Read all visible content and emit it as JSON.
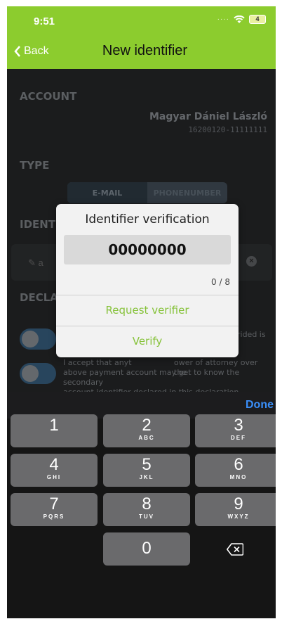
{
  "status": {
    "time": "9:51",
    "battery": "4"
  },
  "nav": {
    "back": "Back",
    "title": "New identifier"
  },
  "form": {
    "account_heading": "ACCOUNT",
    "account_name": "Magyar Dániel László",
    "account_number": "16200120-11111111",
    "type_heading": "TYPE",
    "type_options": [
      "E-MAIL",
      "PHONENUMBER"
    ],
    "type_selected": "E-MAIL",
    "identifier_heading": "IDENT",
    "identifier_value": "a",
    "declaration_heading": "DECLA",
    "declaration_1_partial": "rided is",
    "declaration_2_line1_left": "I accept that anyt",
    "declaration_2_line1_right": "ower of attorney over the",
    "declaration_2_line2": "above payment account may get to know the secondary",
    "declaration_2_line3": "account identifier declared in this declaration"
  },
  "dialog": {
    "title": "Identifier verification",
    "value": "00000000",
    "counter": "0 / 8",
    "request_button": "Request verifier",
    "verify_button": "Verify"
  },
  "keyboard": {
    "done": "Done",
    "keys": [
      {
        "num": "1",
        "letters": ""
      },
      {
        "num": "2",
        "letters": "ABC"
      },
      {
        "num": "3",
        "letters": "DEF"
      },
      {
        "num": "4",
        "letters": "GHI"
      },
      {
        "num": "5",
        "letters": "JKL"
      },
      {
        "num": "6",
        "letters": "MNO"
      },
      {
        "num": "7",
        "letters": "PQRS"
      },
      {
        "num": "8",
        "letters": "TUV"
      },
      {
        "num": "9",
        "letters": "WXYZ"
      },
      {
        "num": "0",
        "letters": ""
      }
    ]
  },
  "colors": {
    "accent": "#8ccc2e",
    "dialog_button": "#86c23a",
    "done": "#3a8ef7"
  }
}
